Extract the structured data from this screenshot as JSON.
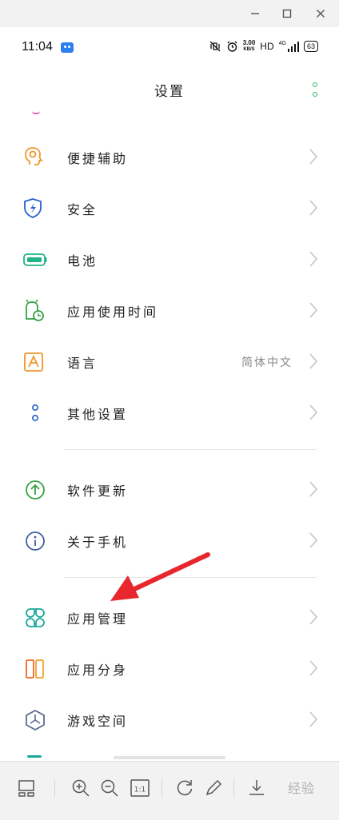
{
  "window": {
    "minimize_icon": "minimize-icon",
    "maximize_icon": "maximize-icon",
    "close_icon": "close-icon"
  },
  "status_bar": {
    "time": "11:04",
    "speed_value": "3.00",
    "speed_unit": "KB/S",
    "network": "HD",
    "signal_label": "4G",
    "battery": "63"
  },
  "header": {
    "title": "设置",
    "more_icon": "more-vertical-icon"
  },
  "settings": {
    "items": [
      {
        "label": "便捷辅助",
        "icon": "accessibility-icon",
        "color": "#f0962b"
      },
      {
        "label": "安全",
        "icon": "security-shield-icon",
        "color": "#2a5fd0"
      },
      {
        "label": "电池",
        "icon": "battery-icon",
        "color": "#20b487"
      },
      {
        "label": "应用使用时间",
        "icon": "app-usage-time-icon",
        "color": "#35a244"
      },
      {
        "label": "语言",
        "value": "简体中文",
        "icon": "language-icon",
        "color": "#f0962b"
      },
      {
        "label": "其他设置",
        "icon": "other-settings-icon",
        "color": "#3d6fd0"
      },
      {
        "label": "软件更新",
        "icon": "software-update-icon",
        "color": "#35a244"
      },
      {
        "label": "关于手机",
        "icon": "about-phone-icon",
        "color": "#3d5fa0"
      },
      {
        "label": "应用管理",
        "icon": "app-management-icon",
        "color": "#1aa89b"
      },
      {
        "label": "应用分身",
        "icon": "app-clone-icon",
        "color": "#ee6a2a"
      },
      {
        "label": "游戏空间",
        "icon": "game-space-icon",
        "color": "#5a6a8a"
      }
    ]
  },
  "annotation": {
    "arrow_color": "#e8262d"
  },
  "toolbar": {
    "icons": [
      "layout-icon",
      "zoom-in-icon",
      "zoom-out-icon",
      "actual-size-icon",
      "rotate-icon",
      "edit-icon",
      "download-icon"
    ],
    "actual_size_label": "1:1",
    "watermark": "经验"
  }
}
